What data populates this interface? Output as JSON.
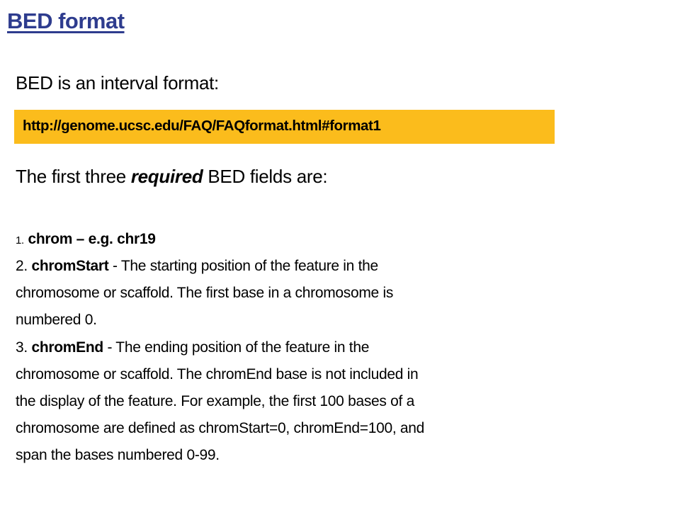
{
  "title": "BED format",
  "intro": "BED is an interval format:",
  "url": "http://genome.ucsc.edu/FAQ/FAQformat.html#format1",
  "fields_heading": {
    "pre": "The first three ",
    "emph": "required",
    "post": " BED fields are:"
  },
  "fields": [
    {
      "num": "1.",
      "name": "chrom – e.g. chr19"
    },
    {
      "num": "2.",
      "name": "chromStart",
      "lines": [
        " - The starting position of the feature in the",
        "chromosome or scaffold. The first base in a chromosome is",
        "numbered 0."
      ]
    },
    {
      "num": "3.",
      "name": "chromEnd",
      "lines": [
        " - The ending position of the feature in the",
        "chromosome or scaffold. The chromEnd base is not included in",
        "the display of the feature. For example, the first 100 bases of a",
        "chromosome are defined as chromStart=0, chromEnd=100, and",
        "span the bases numbered 0-99."
      ]
    }
  ],
  "colors": {
    "title": "#2E3C8E",
    "url_highlight": "#FBBC1C"
  }
}
